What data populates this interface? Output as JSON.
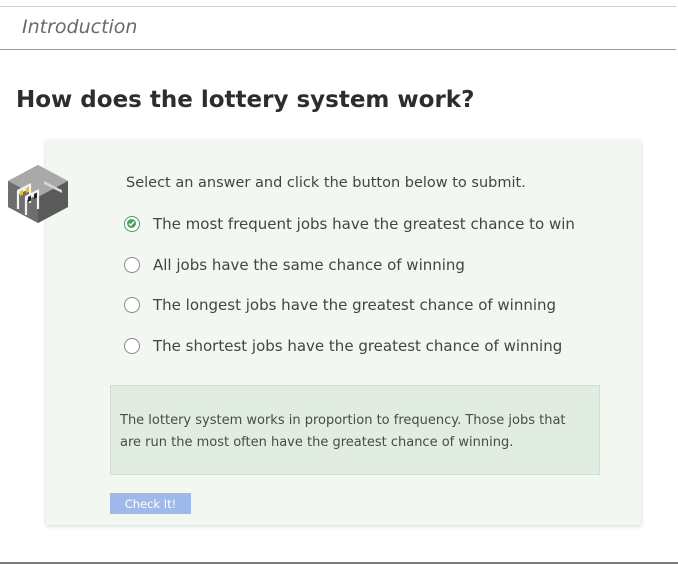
{
  "section": {
    "label": "Introduction"
  },
  "question": {
    "title": "How does the lottery system work?",
    "instructions": "Select an answer and click the button below to submit."
  },
  "options": [
    {
      "label": "The most frequent jobs have the greatest chance to win",
      "selected": true
    },
    {
      "label": "All jobs have the same chance of winning",
      "selected": false
    },
    {
      "label": "The longest jobs have the greatest chance of winning",
      "selected": false
    },
    {
      "label": "The shortest jobs have the greatest chance of winning",
      "selected": false
    }
  ],
  "feedback": {
    "text": "The lottery system works in proportion to frequency. Those jobs that are run the most often have the greatest chance of winning."
  },
  "check_button": {
    "label": "Check It!"
  },
  "icons": {
    "quiz": "hurdle-icon",
    "selected": "check-circle-icon",
    "unselected": "radio-circle-icon"
  },
  "colors": {
    "card_background": "#f2f7f2",
    "feedback_background": "#e2ede1",
    "selected_green": "#4aa05a",
    "button_blue": "#9fb9ea"
  }
}
